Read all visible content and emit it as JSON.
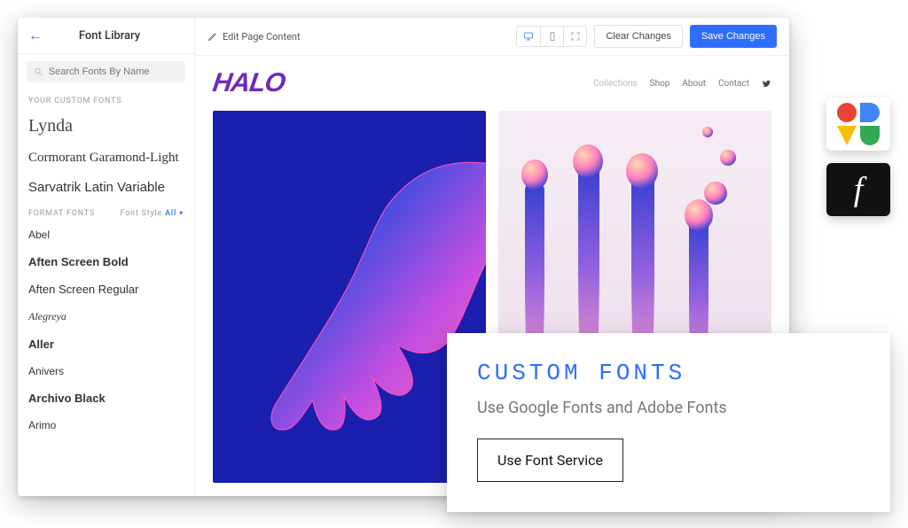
{
  "sidebar": {
    "title": "Font Library",
    "search_placeholder": "Search Fonts By Name",
    "custom_label": "YOUR CUSTOM FONTS",
    "custom_fonts": [
      "Lynda",
      "Cormorant Garamond-Light",
      "Sarvatrik Latin Variable"
    ],
    "format_label": "FORMAT FONTS",
    "filter_label": "Font Style",
    "filter_value": "All",
    "format_fonts": [
      "Abel",
      "Aften Screen Bold",
      "Aften Screen Regular",
      "Alegreya",
      "Aller",
      "Anivers",
      "Archivo Black",
      "Arimo"
    ]
  },
  "toolbar": {
    "edit_label": "Edit Page Content",
    "clear": "Clear Changes",
    "save": "Save Changes"
  },
  "site": {
    "logo": "HALO",
    "nav": [
      "Collections",
      "Shop",
      "About",
      "Contact"
    ]
  },
  "overlay": {
    "title": "CUSTOM FONTS",
    "subtitle": "Use Google Fonts and Adobe Fonts",
    "cta": "Use Font Service"
  },
  "badges": {
    "google": "google-fonts-icon",
    "adobe": "adobe-fonts-icon"
  }
}
